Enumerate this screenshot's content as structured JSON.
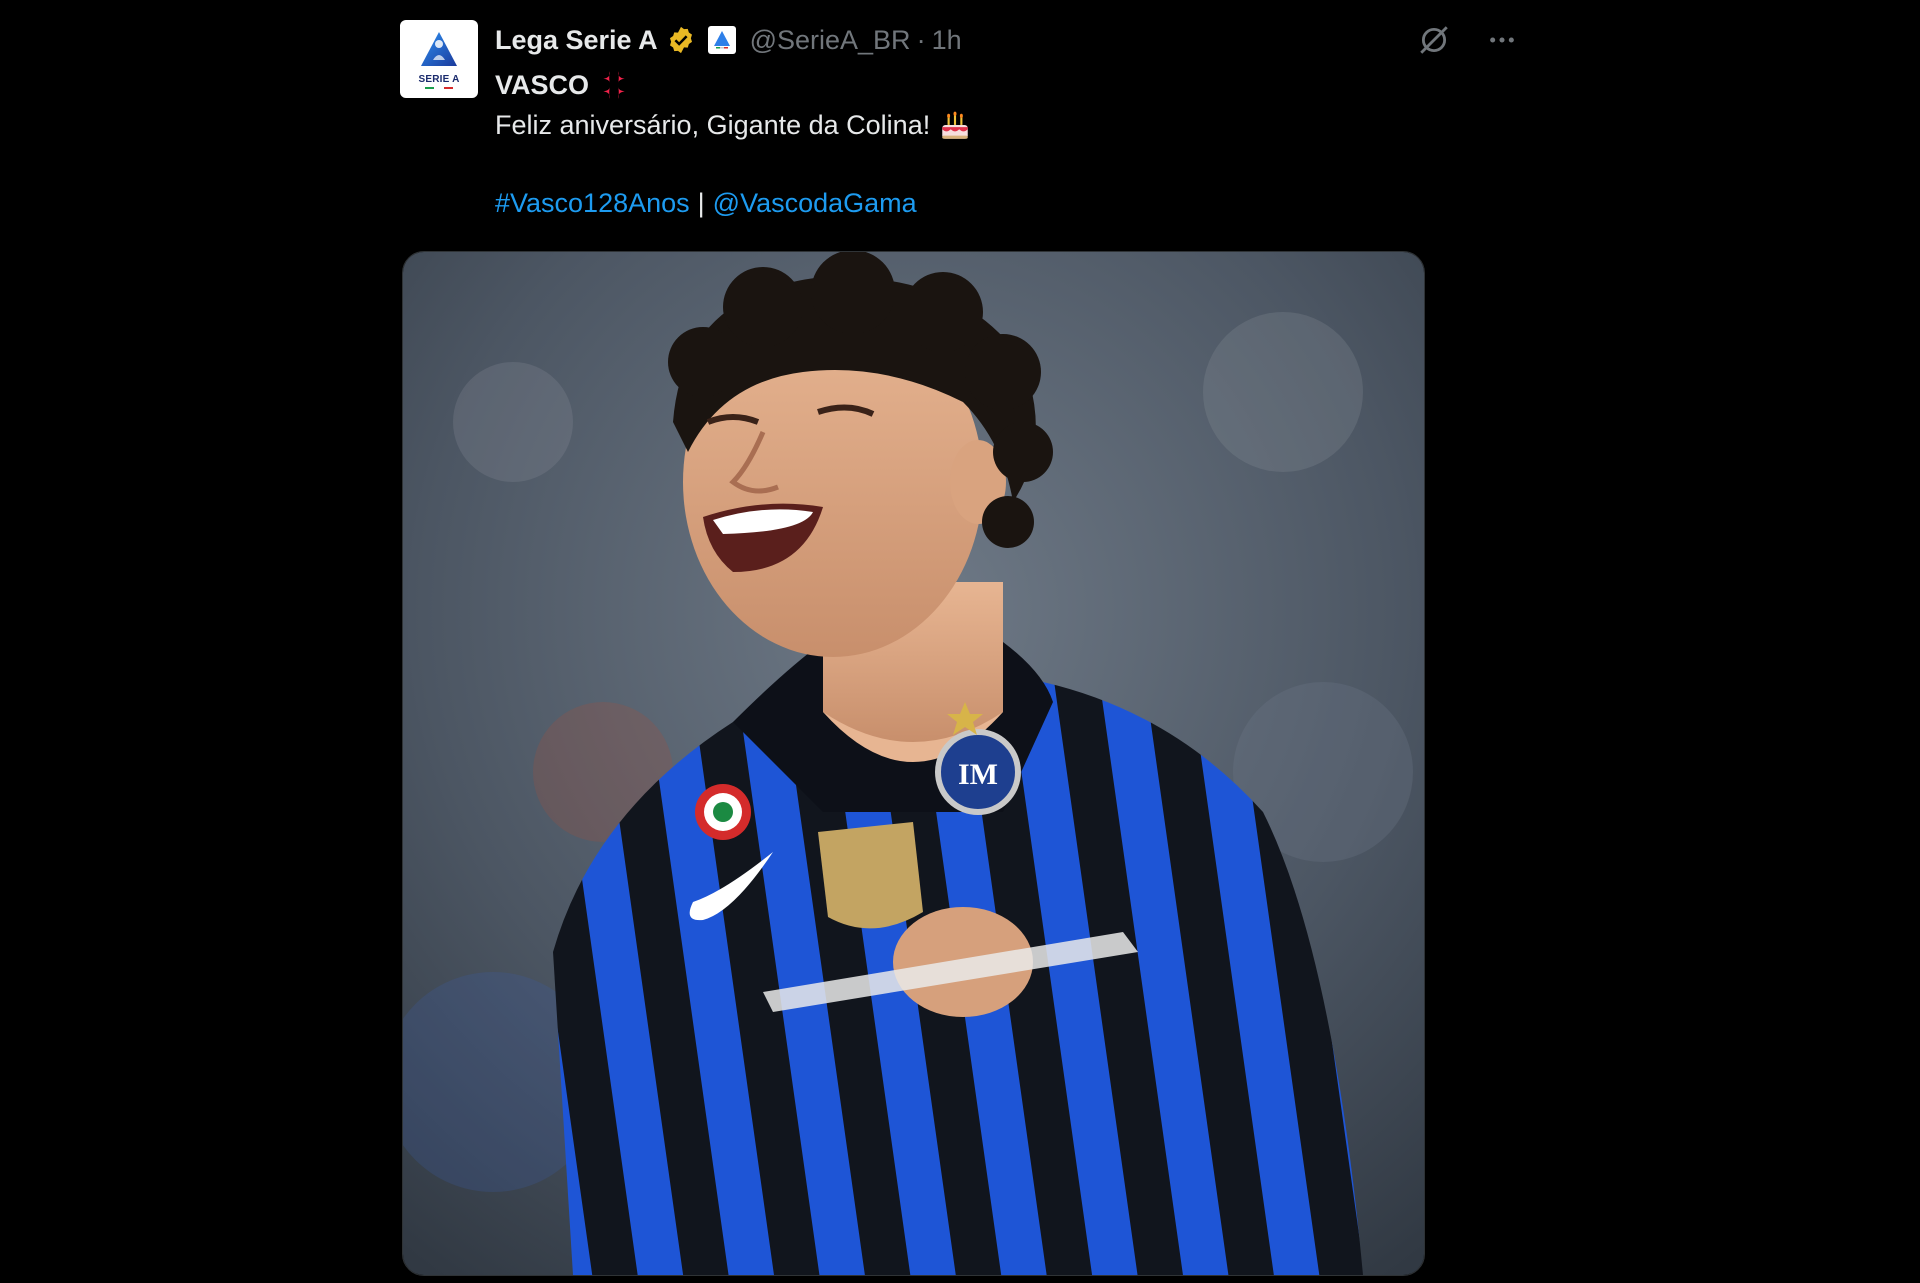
{
  "tweet": {
    "avatar_logo_text": "SERIE A",
    "display_name": "Lega Serie A",
    "handle": "@SerieA_BR",
    "separator": "·",
    "time": "1h",
    "line1": "VASCO",
    "line2": "Feliz aniversário, Gigante da Colina!",
    "hashtag": "#Vasco128Anos",
    "divider": "|",
    "mention": "@VascodaGama",
    "icons": {
      "verified": "verified-badge-icon",
      "affiliate": "serie-a-affiliate-icon",
      "grok": "grok-icon",
      "more": "more-icon",
      "anger": "anger-symbol-icon",
      "cake": "birthday-cake-icon"
    },
    "colors": {
      "background": "#000000",
      "text": "#e7e9ea",
      "muted": "#71767b",
      "link": "#1d9bf0",
      "verified": "#e9b824"
    },
    "media": {
      "type": "photo",
      "description_icon": "football-player-photo"
    }
  }
}
